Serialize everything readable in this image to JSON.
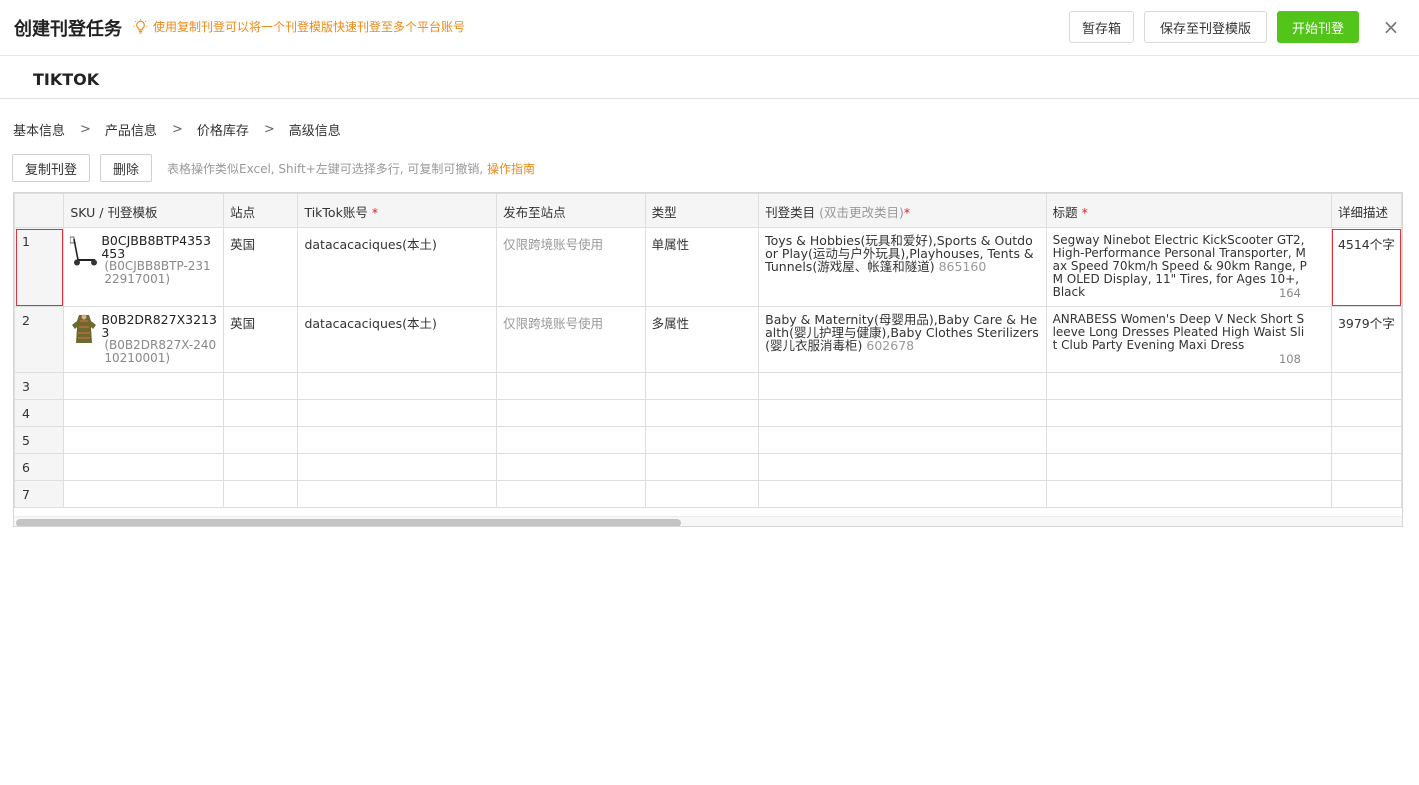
{
  "header": {
    "title": "创建刊登任务",
    "hint": "使用复制刊登可以将一个刊登模版快速刊登至多个平台账号",
    "buttons": {
      "draft": "暂存箱",
      "save_template": "保存至刊登模版",
      "start": "开始刊登"
    },
    "close": "×",
    "colors": {
      "accent_green": "#52c41a",
      "hint_orange": "#ef8a16",
      "selected_red": "#d9363e"
    }
  },
  "platform_tab": "TIKTOK",
  "steps": [
    "基本信息",
    "产品信息",
    "价格库存",
    "高级信息"
  ],
  "step_separator": ">",
  "toolbar": {
    "copy": "复制刊登",
    "delete": "删除",
    "tip": "表格操作类似Excel, Shift+左键可选择多行, 可复制可撤销,",
    "guide_link": "操作指南"
  },
  "table": {
    "columns": {
      "sku": "SKU / 刊登模板",
      "site": "站点",
      "account": "TikTok账号",
      "publish_site": "发布至站点",
      "type": "类型",
      "category": "刊登类目",
      "category_hint": "(双击更改类目)",
      "title": "标题",
      "description": "详细描述",
      "required_mark": "*"
    },
    "rows": [
      {
        "num": "1",
        "sku": "B0CJBB8BTP4353453",
        "sku_sub": "(B0CJBB8BTP-23122917001)",
        "image_icon": "scooter-thumbnail",
        "site": "英国",
        "account": "datacacaciques(本土)",
        "publish_site": "仅限跨境账号使用",
        "type": "单属性",
        "category": "Toys & Hobbies(玩具和爱好),Sports & Outdoor Play(运动与户外玩具),Playhouses, Tents & Tunnels(游戏屋、帐篷和隧道)",
        "category_id": "865160",
        "title": "Segway Ninebot Electric KickScooter GT2, High-Performance Personal Transporter, Max Speed 70km/h Speed & 90km Range, PM OLED Display, 11\" Tires, for Ages 10+, Black",
        "title_count": "164",
        "description": "4514个字"
      },
      {
        "num": "2",
        "sku": "B0B2DR827X32133",
        "sku_sub": "(B0B2DR827X-24010210001)",
        "image_icon": "dress-thumbnail",
        "site": "英国",
        "account": "datacacaciques(本土)",
        "publish_site": "仅限跨境账号使用",
        "type": "多属性",
        "category": "Baby & Maternity(母婴用品),Baby Care & Health(婴儿护理与健康),Baby Clothes Sterilizers(婴儿衣服消毒柜)",
        "category_id": "602678",
        "title": "ANRABESS Women's Deep V Neck Short Sleeve Long Dresses Pleated High Waist Slit Club Party Evening Maxi Dress",
        "title_count": "108",
        "description": "3979个字"
      }
    ],
    "empty_rows": [
      "3",
      "4",
      "5",
      "6",
      "7"
    ]
  }
}
